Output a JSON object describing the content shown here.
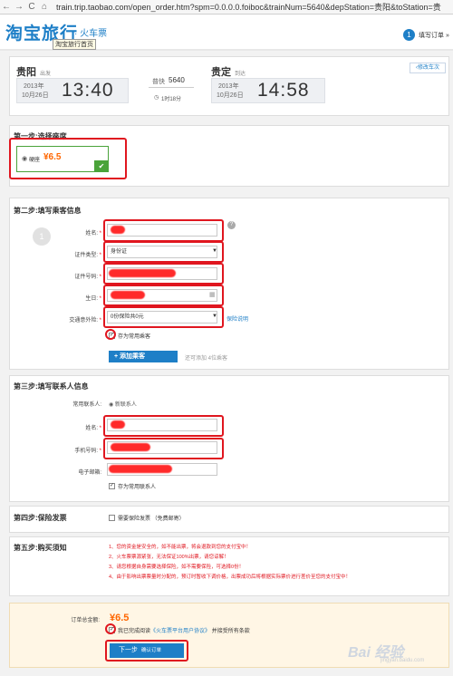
{
  "browser": {
    "back": "←",
    "forward": "→",
    "reload": "C",
    "home": "⌂",
    "url": "train.trip.taobao.com/open_order.htm?spm=0.0.0.0.foiboc&trainNum=5640&depStation=贵阳&toStation=贵"
  },
  "header": {
    "logo": "淘宝旅行",
    "logo_sub": "· 火车票",
    "tooltip": "淘宝旅行首页",
    "step_num": "1",
    "step_label": "填写订单 »"
  },
  "summary": {
    "from_station": "贵阳",
    "from_tag": "出发",
    "dep_year": "2013年",
    "dep_date": "10月26日",
    "dep_time": "13:40",
    "train_label": "普快",
    "train_num": "5640",
    "duration": "1时18分",
    "to_station": "贵定",
    "to_tag": "到达",
    "arr_year": "2013年",
    "arr_date": "10月26日",
    "arr_time": "14:58",
    "modify": "‹修改车次"
  },
  "step1": {
    "title": "第一步:选择座席",
    "seat_name": "硬座",
    "price": "¥6.5"
  },
  "step2": {
    "title": "第二步:填写乘客信息",
    "passenger_no": "1",
    "name_label": "姓名:",
    "id_type_label": "证件类型:",
    "id_type_value": "身份证",
    "id_no_label": "证件号码:",
    "birthday_label": "生日:",
    "insurance_label": "交通意外险:",
    "insurance_value": "0份保险共0元",
    "insurance_link": "保险说明",
    "save_passenger": "存为常用乘客",
    "add_passenger": "+ 添加乘客",
    "add_hint": "还可添加 4位乘客"
  },
  "step3": {
    "title": "第三步:填写联系人信息",
    "common_label": "常用联系人:",
    "new_contact": "新联系人",
    "name_label": "姓名:",
    "phone_label": "手机号码:",
    "email_label": "电子邮箱:",
    "save_contact": "存为常用联系人"
  },
  "step4": {
    "title": "第四步:保险发票",
    "invoice": "需要保险发票 （免费邮寄）"
  },
  "step5": {
    "title": "第五步:购买须知",
    "notes": [
      "1、您的资金是安全的，如不能出票，将会退款到您的支付宝中！",
      "2、火车票票源紧张，无法保证100%出票，请您谅解！",
      "3、请您根据自身需要选择保险，如不需要保险，可选择0份！",
      "4、由于影响出票票量时分配的，预订时暂收下调价格，出票成功后将根据实际票价进行差价至您的支付宝中！"
    ]
  },
  "footer": {
    "total_label": "订单总金额:",
    "total_price": "¥6.5",
    "agree_prefix": "我已完成阅读",
    "agree_link": "《火车票平台用户协议》",
    "agree_suffix": "并接受所有条款",
    "next": "下一步",
    "next_sub": "确认订单"
  },
  "watermark": {
    "text": "Bai 经验",
    "sub": "jingyan.baidu.com"
  },
  "colors": {
    "brand_blue": "#1e7fc7",
    "price_orange": "#ff6600",
    "annotation_red": "#e0161f",
    "seat_green": "#4aa33a"
  }
}
